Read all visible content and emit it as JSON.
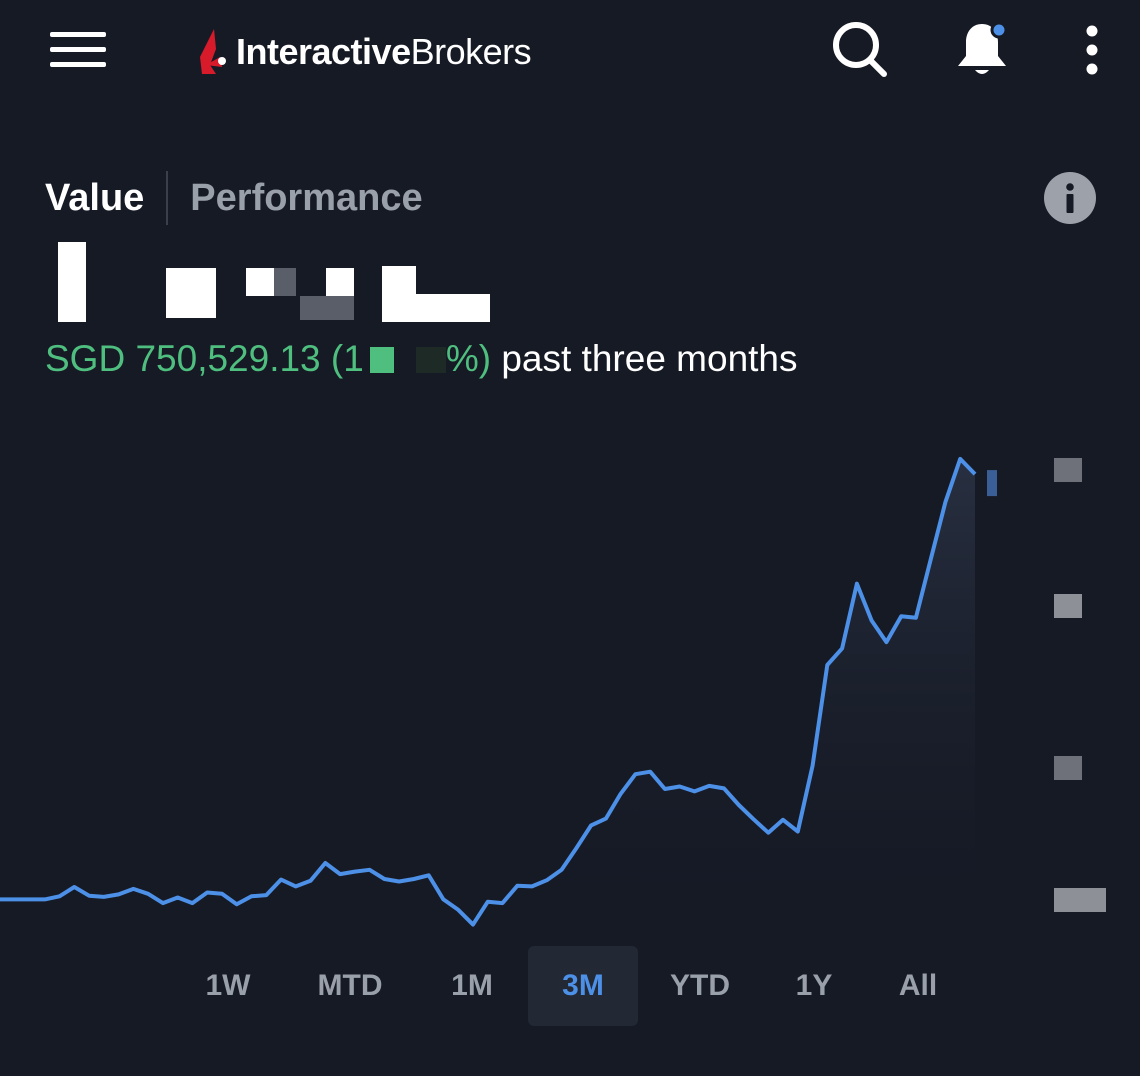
{
  "header": {
    "logo_bold": "Interactive",
    "logo_light": "Brokers",
    "menu_icon": "hamburger-menu-icon",
    "search_icon": "search-icon",
    "bell_icon": "bell-icon",
    "more_icon": "more-vertical-icon",
    "notification_dot_color": "#4d90e8",
    "brand_color": "#d81b2b"
  },
  "tabs": {
    "value_label": "Value",
    "performance_label": "Performance",
    "info_icon": "info-icon"
  },
  "summary": {
    "change_prefix": "SGD 750,529.13 (1",
    "change_suffix": "%)",
    "period_label": " past three months",
    "positive_color": "#4fbf7f"
  },
  "chart_data": {
    "type": "area",
    "title": "",
    "xlabel": "",
    "ylabel": "",
    "line_color": "#4d90e8",
    "grid": false,
    "series": [
      {
        "values": [
          0.82,
          0.82,
          1.41,
          3.17,
          1.52,
          1.29,
          1.76,
          2.81,
          1.88,
          0.12,
          1.17,
          0.11,
          2.12,
          1.88,
          -0.12,
          1.41,
          1.64,
          4.57,
          3.29,
          4.34,
          7.73,
          5.62,
          6.09,
          6.44,
          4.69,
          4.22,
          4.69,
          5.39,
          0.82,
          -1.17,
          -3.98,
          0.35,
          0.12,
          3.4,
          3.29,
          4.46,
          6.44,
          10.55,
          14.88,
          16.17,
          20.86,
          24.61,
          25.07,
          21.79,
          22.26,
          21.33,
          22.38,
          21.91,
          18.75,
          16.05,
          13.48,
          15.94,
          13.71,
          26.24,
          45.35,
          48.5,
          60.8,
          53.8,
          49.7,
          54.6,
          54.34,
          65.4,
          76.36,
          84.5,
          81.62
        ]
      }
    ],
    "ylim": [
      -5,
      90
    ]
  },
  "ranges": [
    {
      "label": "1W",
      "active": false
    },
    {
      "label": "MTD",
      "active": false
    },
    {
      "label": "1M",
      "active": false
    },
    {
      "label": "3M",
      "active": true
    },
    {
      "label": "YTD",
      "active": false
    },
    {
      "label": "1Y",
      "active": false
    },
    {
      "label": "All",
      "active": false
    }
  ]
}
